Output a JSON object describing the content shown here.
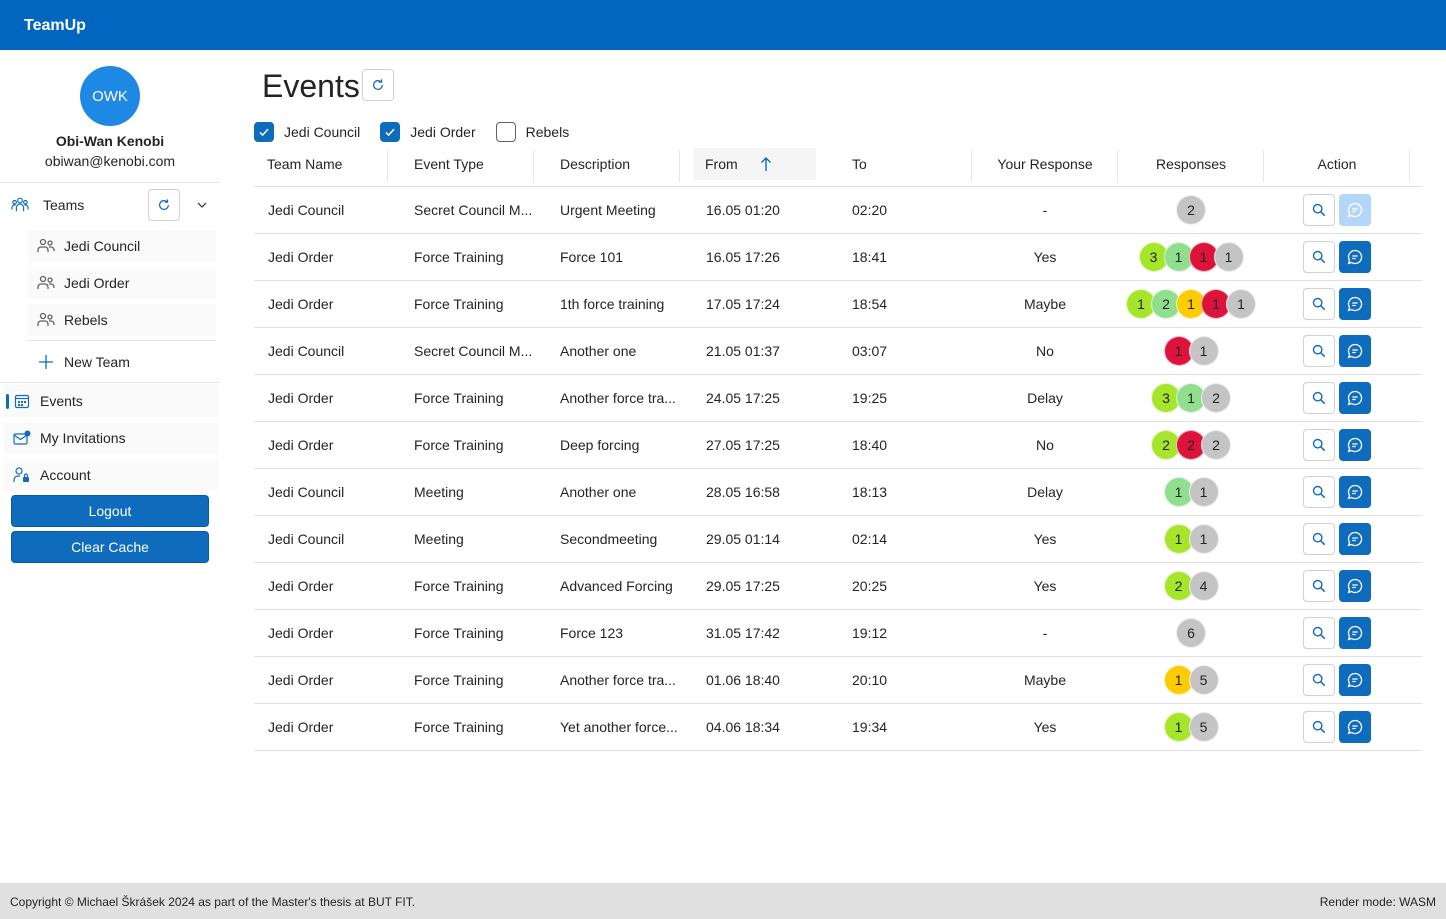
{
  "app": {
    "title": "TeamUp"
  },
  "user": {
    "initials": "OWK",
    "name": "Obi-Wan Kenobi",
    "email": "obiwan@kenobi.com"
  },
  "sidebar": {
    "teams_label": "Teams",
    "teams": [
      {
        "label": "Jedi Council"
      },
      {
        "label": "Jedi Order"
      },
      {
        "label": "Rebels"
      }
    ],
    "new_team_label": "New Team",
    "events_label": "Events",
    "invitations_label": "My Invitations",
    "account_label": "Account",
    "logout_label": "Logout",
    "clear_cache_label": "Clear Cache"
  },
  "main": {
    "title": "Events",
    "filters": [
      {
        "label": "Jedi Council",
        "checked": true
      },
      {
        "label": "Jedi Order",
        "checked": true
      },
      {
        "label": "Rebels",
        "checked": false
      }
    ],
    "columns": [
      "Team Name",
      "Event Type",
      "Description",
      "From",
      "To",
      "Your Response",
      "Responses",
      "Action"
    ],
    "rows": [
      {
        "team": "Jedi Council",
        "type": "Secret Council M...",
        "desc": "Urgent Meeting",
        "from": "16.05 01:20",
        "to": "02:20",
        "response": "-",
        "responses": [
          {
            "n": "2",
            "c": "grey"
          }
        ],
        "chat_enabled": false
      },
      {
        "team": "Jedi Order",
        "type": "Force Training",
        "desc": "Force 101",
        "from": "16.05 17:26",
        "to": "18:41",
        "response": "Yes",
        "responses": [
          {
            "n": "3",
            "c": "lime"
          },
          {
            "n": "1",
            "c": "lightgreen"
          },
          {
            "n": "1",
            "c": "red"
          },
          {
            "n": "1",
            "c": "grey"
          }
        ],
        "chat_enabled": true
      },
      {
        "team": "Jedi Order",
        "type": "Force Training",
        "desc": "1th force training",
        "from": "17.05 17:24",
        "to": "18:54",
        "response": "Maybe",
        "responses": [
          {
            "n": "1",
            "c": "lime"
          },
          {
            "n": "2",
            "c": "lightgreen"
          },
          {
            "n": "1",
            "c": "yellow"
          },
          {
            "n": "1",
            "c": "red"
          },
          {
            "n": "1",
            "c": "grey"
          }
        ],
        "chat_enabled": true
      },
      {
        "team": "Jedi Council",
        "type": "Secret Council M...",
        "desc": "Another one",
        "from": "21.05 01:37",
        "to": "03:07",
        "response": "No",
        "responses": [
          {
            "n": "1",
            "c": "red"
          },
          {
            "n": "1",
            "c": "grey"
          }
        ],
        "chat_enabled": true
      },
      {
        "team": "Jedi Order",
        "type": "Force Training",
        "desc": "Another force tra...",
        "from": "24.05 17:25",
        "to": "19:25",
        "response": "Delay",
        "responses": [
          {
            "n": "3",
            "c": "lime"
          },
          {
            "n": "1",
            "c": "lightgreen"
          },
          {
            "n": "2",
            "c": "grey"
          }
        ],
        "chat_enabled": true
      },
      {
        "team": "Jedi Order",
        "type": "Force Training",
        "desc": "Deep forcing",
        "from": "27.05 17:25",
        "to": "18:40",
        "response": "No",
        "responses": [
          {
            "n": "2",
            "c": "lime"
          },
          {
            "n": "2",
            "c": "red"
          },
          {
            "n": "2",
            "c": "grey"
          }
        ],
        "chat_enabled": true
      },
      {
        "team": "Jedi Council",
        "type": "Meeting",
        "desc": "Another one",
        "from": "28.05 16:58",
        "to": "18:13",
        "response": "Delay",
        "responses": [
          {
            "n": "1",
            "c": "lightgreen"
          },
          {
            "n": "1",
            "c": "grey"
          }
        ],
        "chat_enabled": true
      },
      {
        "team": "Jedi Council",
        "type": "Meeting",
        "desc": "Secondmeeting",
        "from": "29.05 01:14",
        "to": "02:14",
        "response": "Yes",
        "responses": [
          {
            "n": "1",
            "c": "lime"
          },
          {
            "n": "1",
            "c": "grey"
          }
        ],
        "chat_enabled": true
      },
      {
        "team": "Jedi Order",
        "type": "Force Training",
        "desc": "Advanced Forcing",
        "from": "29.05 17:25",
        "to": "20:25",
        "response": "Yes",
        "responses": [
          {
            "n": "2",
            "c": "lime"
          },
          {
            "n": "4",
            "c": "grey"
          }
        ],
        "chat_enabled": true
      },
      {
        "team": "Jedi Order",
        "type": "Force Training",
        "desc": "Force 123",
        "from": "31.05 17:42",
        "to": "19:12",
        "response": "-",
        "responses": [
          {
            "n": "6",
            "c": "grey"
          }
        ],
        "chat_enabled": true
      },
      {
        "team": "Jedi Order",
        "type": "Force Training",
        "desc": "Another force tra...",
        "from": "01.06 18:40",
        "to": "20:10",
        "response": "Maybe",
        "responses": [
          {
            "n": "1",
            "c": "yellow"
          },
          {
            "n": "5",
            "c": "grey"
          }
        ],
        "chat_enabled": true
      },
      {
        "team": "Jedi Order",
        "type": "Force Training",
        "desc": "Yet another force...",
        "from": "04.06 18:34",
        "to": "19:34",
        "response": "Yes",
        "responses": [
          {
            "n": "1",
            "c": "lime"
          },
          {
            "n": "5",
            "c": "grey"
          }
        ],
        "chat_enabled": true
      }
    ]
  },
  "colors": {
    "brand": "#0066c0",
    "accent": "#0f6cbd",
    "lime": "#a6e52b",
    "lightgreen": "#8fdf8f",
    "red": "#dc143c",
    "yellow": "#fccb00",
    "grey": "#c4c4c4"
  },
  "footer": {
    "copyright": "Copyright © Michael Škrášek 2024 as part of the Master's thesis at BUT FIT.",
    "render_mode": "Render mode: WASM"
  }
}
